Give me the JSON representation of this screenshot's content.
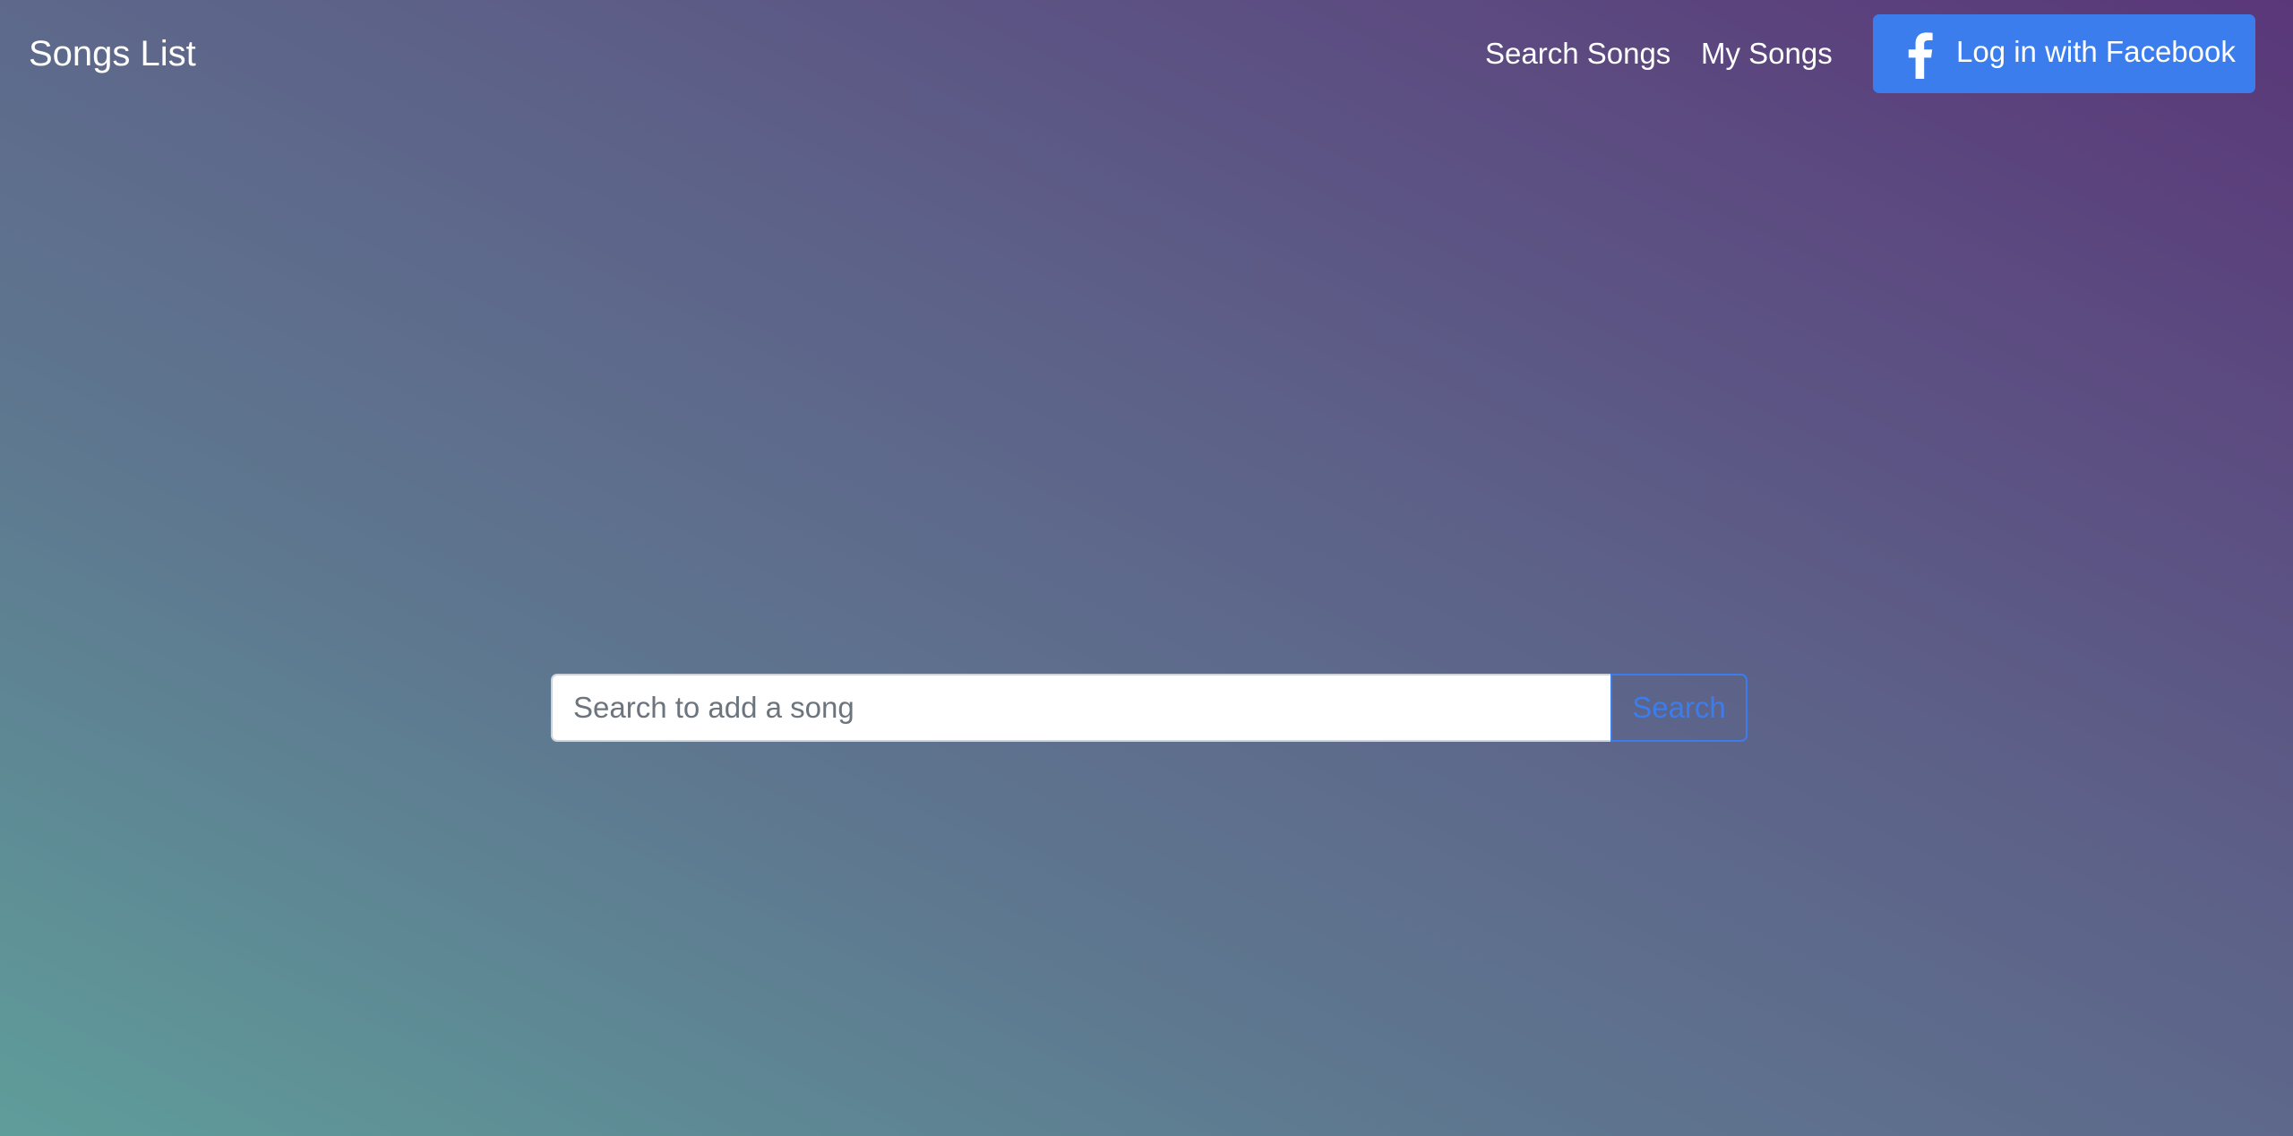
{
  "navbar": {
    "brand": "Songs List",
    "links": {
      "search_songs": "Search Songs",
      "my_songs": "My Songs"
    },
    "facebook_button": {
      "label": "Log in with Facebook",
      "icon": "facebook-icon",
      "color": "#3b7ded"
    }
  },
  "search": {
    "placeholder": "Search to add a song",
    "value": "",
    "button_label": "Search",
    "accent_color": "#3b7ded"
  },
  "theme": {
    "gradient_start": "#5f9d9a",
    "gradient_end": "#5a3779"
  }
}
